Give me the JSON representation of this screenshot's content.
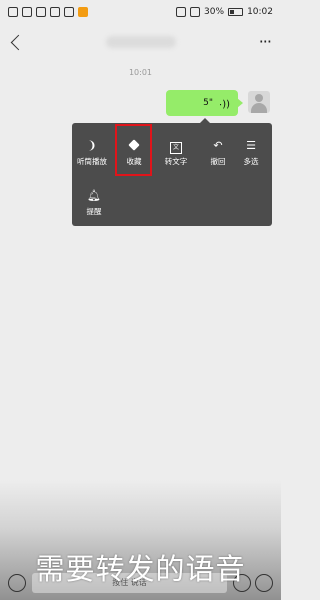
{
  "status_bar": {
    "battery_percent": "30%",
    "time": "10:02"
  },
  "chat": {
    "timestamp": "10:01",
    "voice_duration": "5\""
  },
  "context_menu": {
    "items": [
      {
        "label": "听筒播放",
        "icon": "ear-icon"
      },
      {
        "label": "收藏",
        "icon": "cube-icon"
      },
      {
        "label": "转文字",
        "icon": "text-icon"
      },
      {
        "label": "撤回",
        "icon": "undo-icon"
      },
      {
        "label": "多选",
        "icon": "list-icon"
      },
      {
        "label": "提醒",
        "icon": "bell-icon"
      }
    ],
    "highlight_color": "#e0141a",
    "menu_color": "#4c4c4c"
  },
  "bubble_color": "#95ec69",
  "bottom_bar": {
    "input_placeholder": "按住 说话"
  },
  "caption": "需要转发的语音"
}
